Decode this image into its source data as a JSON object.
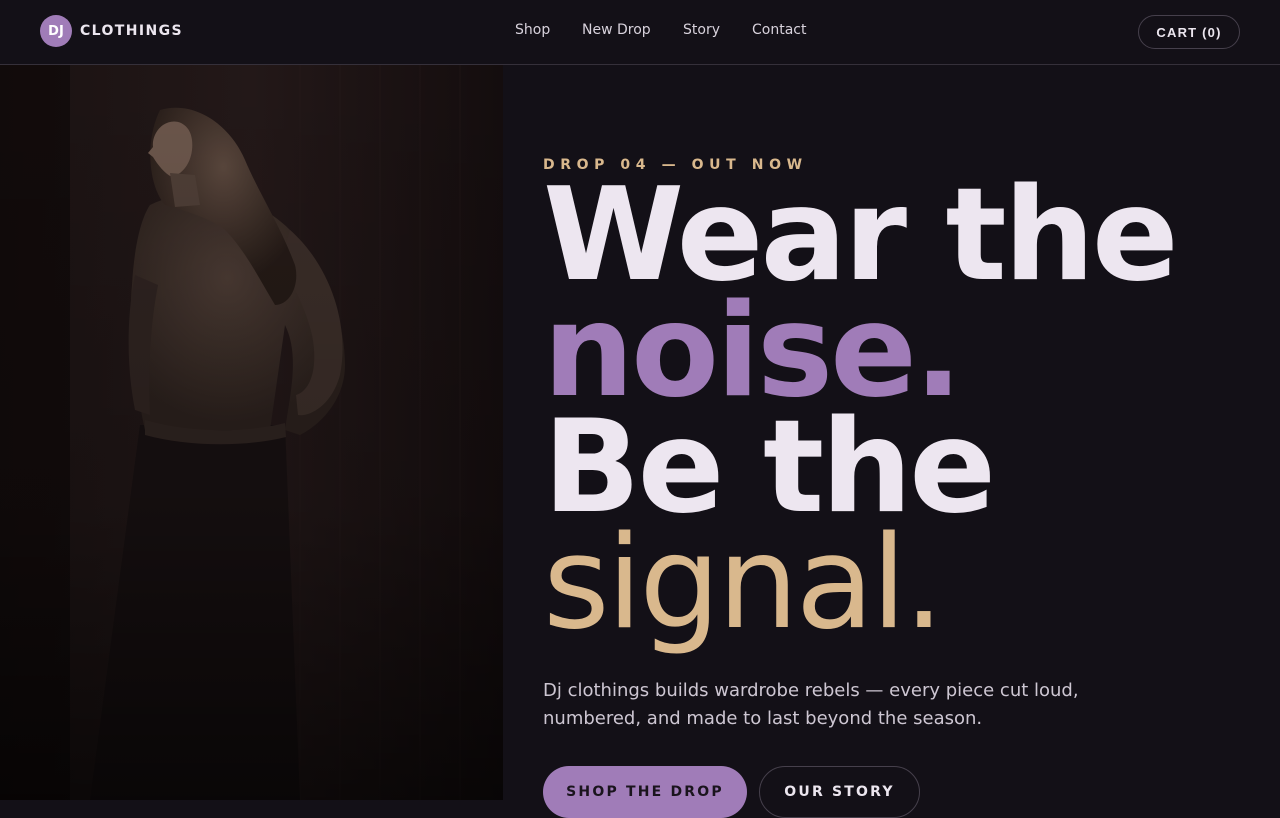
{
  "brand": {
    "badge": "DJ",
    "name": "CLOTHINGS"
  },
  "nav": {
    "links": [
      "Shop",
      "New Drop",
      "Story",
      "Contact"
    ],
    "cart_label": "CART (0)"
  },
  "hero": {
    "eyebrow": "DROP 04 — OUT NOW",
    "headline": [
      "Wear the",
      "noise.",
      "Be the",
      "signal."
    ],
    "description": "Dj clothings builds wardrobe rebels — every piece cut loud, numbered, and made to last beyond the season.",
    "primary_cta": "SHOP THE DROP",
    "secondary_cta": "OUR STORY",
    "image_icon": "model-photo"
  },
  "colors": {
    "background": "#131017",
    "accent_purple": "#a07cb8",
    "accent_gold": "#d9b88d",
    "text_light": "#ede6f0"
  }
}
